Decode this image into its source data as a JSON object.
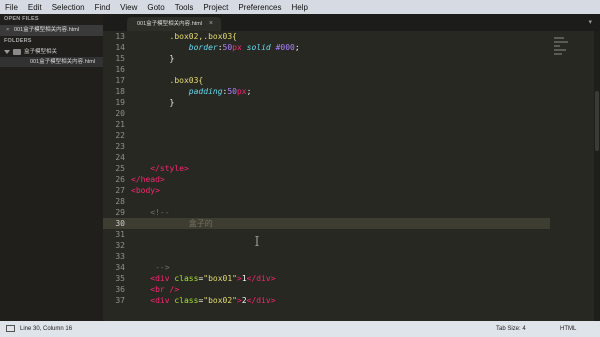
{
  "menu": [
    "File",
    "Edit",
    "Selection",
    "Find",
    "View",
    "Goto",
    "Tools",
    "Project",
    "Preferences",
    "Help"
  ],
  "sidebar": {
    "open_files_label": "OPEN FILES",
    "open_file": "001盒子模型相关内容.html",
    "folders_label": "FOLDERS",
    "folder": "盒子模型相关",
    "folder_file": "001盒子模型相关内容.html"
  },
  "tab": {
    "title": "001盒子模型相关内容.html",
    "close": "×"
  },
  "editor": {
    "lines": [
      {
        "n": "13",
        "c": "        .box02,.box03{"
      },
      {
        "n": "14",
        "c": "            border:50px solid #000;"
      },
      {
        "n": "15",
        "c": "        }"
      },
      {
        "n": "16",
        "c": ""
      },
      {
        "n": "17",
        "c": "        .box03{"
      },
      {
        "n": "18",
        "c": "            padding:50px;"
      },
      {
        "n": "19",
        "c": "        }"
      },
      {
        "n": "20",
        "c": ""
      },
      {
        "n": "21",
        "c": ""
      },
      {
        "n": "22",
        "c": ""
      },
      {
        "n": "23",
        "c": ""
      },
      {
        "n": "24",
        "c": ""
      },
      {
        "n": "25",
        "c": "    </style>"
      },
      {
        "n": "26",
        "c": "</head>"
      },
      {
        "n": "27",
        "c": "<body>"
      },
      {
        "n": "28",
        "c": ""
      },
      {
        "n": "29",
        "c": "    <!--"
      },
      {
        "n": "30",
        "c": "            盒子的"
      },
      {
        "n": "31",
        "c": ""
      },
      {
        "n": "32",
        "c": ""
      },
      {
        "n": "33",
        "c": ""
      },
      {
        "n": "34",
        "c": "     -->"
      },
      {
        "n": "35",
        "c": "    <div class=\"box01\">1</div>"
      },
      {
        "n": "36",
        "c": "    <br />"
      },
      {
        "n": "37",
        "c": "    <div class=\"box02\">2</div>"
      }
    ]
  },
  "status": {
    "position": "Line 30, Column 16",
    "tab_size": "Tab Size: 4",
    "syntax": "HTML"
  },
  "colors": {
    "editor_bg": "#272822",
    "selector": "#e6db74",
    "property": "#66d9ef",
    "number": "#ae81ff",
    "tag": "#f92672",
    "attribute": "#a6e22e",
    "comment": "#75715e"
  }
}
